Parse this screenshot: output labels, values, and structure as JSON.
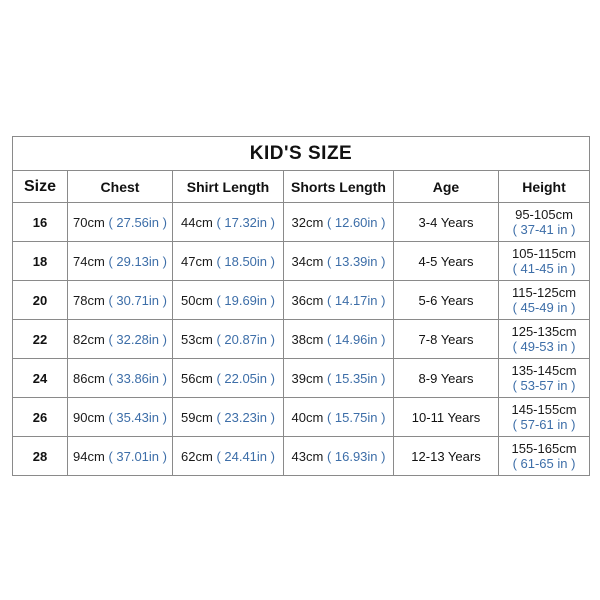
{
  "table": {
    "title": "KID'S SIZE",
    "accent_color": "#3d6ea8",
    "text_color": "#1a1a1a",
    "border_color": "#8a8a8a",
    "background_color": "#ffffff",
    "columns": [
      {
        "key": "size",
        "label": "Size"
      },
      {
        "key": "chest",
        "label": "Chest"
      },
      {
        "key": "shirt",
        "label": "Shirt Length"
      },
      {
        "key": "shorts",
        "label": "Shorts Length"
      },
      {
        "key": "age",
        "label": "Age"
      },
      {
        "key": "height",
        "label": "Height"
      }
    ],
    "rows": [
      {
        "size": "16",
        "chest_cm": "70cm",
        "chest_in": "( 27.56in )",
        "shirt_cm": "44cm",
        "shirt_in": "( 17.32in )",
        "shorts_cm": "32cm",
        "shorts_in": "( 12.60in )",
        "age": "3-4 Years",
        "height_cm": "95-105cm",
        "height_in": "( 37-41 in )"
      },
      {
        "size": "18",
        "chest_cm": "74cm",
        "chest_in": "( 29.13in )",
        "shirt_cm": "47cm",
        "shirt_in": "( 18.50in )",
        "shorts_cm": "34cm",
        "shorts_in": "( 13.39in )",
        "age": "4-5 Years",
        "height_cm": "105-115cm",
        "height_in": "( 41-45 in )"
      },
      {
        "size": "20",
        "chest_cm": "78cm",
        "chest_in": "( 30.71in )",
        "shirt_cm": "50cm",
        "shirt_in": "( 19.69in )",
        "shorts_cm": "36cm",
        "shorts_in": "( 14.17in )",
        "age": "5-6 Years",
        "height_cm": "115-125cm",
        "height_in": "( 45-49 in )"
      },
      {
        "size": "22",
        "chest_cm": "82cm",
        "chest_in": "( 32.28in )",
        "shirt_cm": "53cm",
        "shirt_in": "( 20.87in )",
        "shorts_cm": "38cm",
        "shorts_in": "( 14.96in )",
        "age": "7-8 Years",
        "height_cm": "125-135cm",
        "height_in": "( 49-53 in )"
      },
      {
        "size": "24",
        "chest_cm": "86cm",
        "chest_in": "( 33.86in )",
        "shirt_cm": "56cm",
        "shirt_in": "( 22.05in )",
        "shorts_cm": "39cm",
        "shorts_in": "( 15.35in )",
        "age": "8-9 Years",
        "height_cm": "135-145cm",
        "height_in": "( 53-57 in )"
      },
      {
        "size": "26",
        "chest_cm": "90cm",
        "chest_in": "( 35.43in )",
        "shirt_cm": "59cm",
        "shirt_in": "( 23.23in )",
        "shorts_cm": "40cm",
        "shorts_in": "( 15.75in )",
        "age": "10-11 Years",
        "height_cm": "145-155cm",
        "height_in": "( 57-61 in )"
      },
      {
        "size": "28",
        "chest_cm": "94cm",
        "chest_in": "( 37.01in )",
        "shirt_cm": "62cm",
        "shirt_in": "( 24.41in )",
        "shorts_cm": "43cm",
        "shorts_in": "( 16.93in )",
        "age": "12-13 Years",
        "height_cm": "155-165cm",
        "height_in": "( 61-65 in )"
      }
    ]
  }
}
